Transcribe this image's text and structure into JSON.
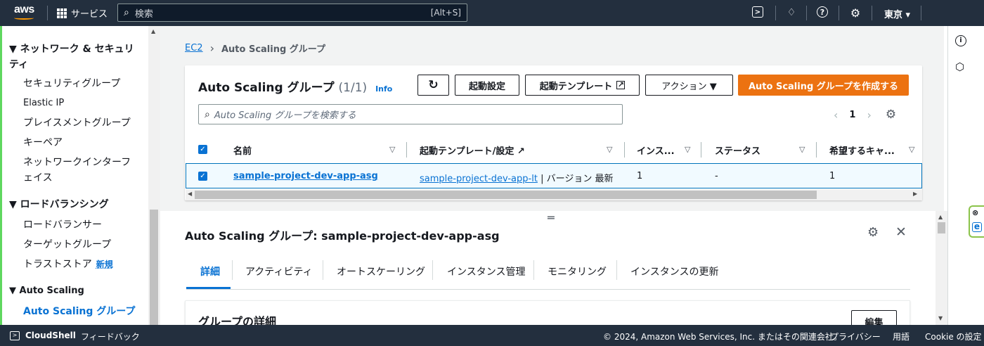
{
  "topbar": {
    "logo": "aws",
    "services_label": "サービス",
    "search_placeholder": "検索",
    "search_shortcut": "[Alt+S]",
    "region": "東京 ▾"
  },
  "sidebar": {
    "network_head": "▼ ネットワーク & セキュリティ",
    "items_network": [
      "セキュリティグループ",
      "Elastic IP",
      "プレイスメントグループ",
      "キーペア",
      "ネットワークインターフェイス"
    ],
    "lb_head": "▼ ロードバランシング",
    "items_lb": [
      "ロードバランサー",
      "ターゲットグループ",
      "トラストストア"
    ],
    "new_badge": "新規",
    "as_head": "▼ Auto Scaling",
    "items_as": [
      "Auto Scaling グループ"
    ]
  },
  "breadcrumb": {
    "root": "EC2",
    "sep": "›",
    "current": "Auto Scaling グループ"
  },
  "asg_table": {
    "title": "Auto Scaling グループ",
    "count": "(1/1)",
    "info": "Info",
    "buttons": {
      "refresh": "↻",
      "launch_config": "起動設定",
      "launch_template": "起動テンプレート",
      "actions": "アクション ▼",
      "create": "Auto Scaling グループを作成する"
    },
    "search_placeholder": "Auto Scaling グループを検索する",
    "page": "1",
    "columns": [
      "名前",
      "起動テンプレート/設定",
      "インス...",
      "ステータス",
      "希望するキャ..."
    ],
    "rows": [
      {
        "name": "sample-project-dev-app-asg",
        "template": "sample-project-dev-app-lt",
        "version": "| バージョン 最新",
        "instances": "1",
        "status": "-",
        "desired": "1"
      }
    ]
  },
  "detail_panel": {
    "title": "Auto Scaling グループ: sample-project-dev-app-asg",
    "tabs": [
      "詳細",
      "アクティビティ",
      "オートスケーリング",
      "インスタンス管理",
      "モニタリング",
      "インスタンスの更新"
    ],
    "section_title": "グループの詳細",
    "edit_label": "編集"
  },
  "footer": {
    "cloudshell": "CloudShell",
    "feedback": "フィードバック",
    "copyright": "© 2024, Amazon Web Services, Inc. またはその関連会社。",
    "privacy": "プライバシー",
    "terms": "用語",
    "cookie": "Cookie の設定"
  },
  "colors": {
    "topbar": "#232f3e",
    "link": "#0972d3",
    "primary": "#ec7211"
  }
}
